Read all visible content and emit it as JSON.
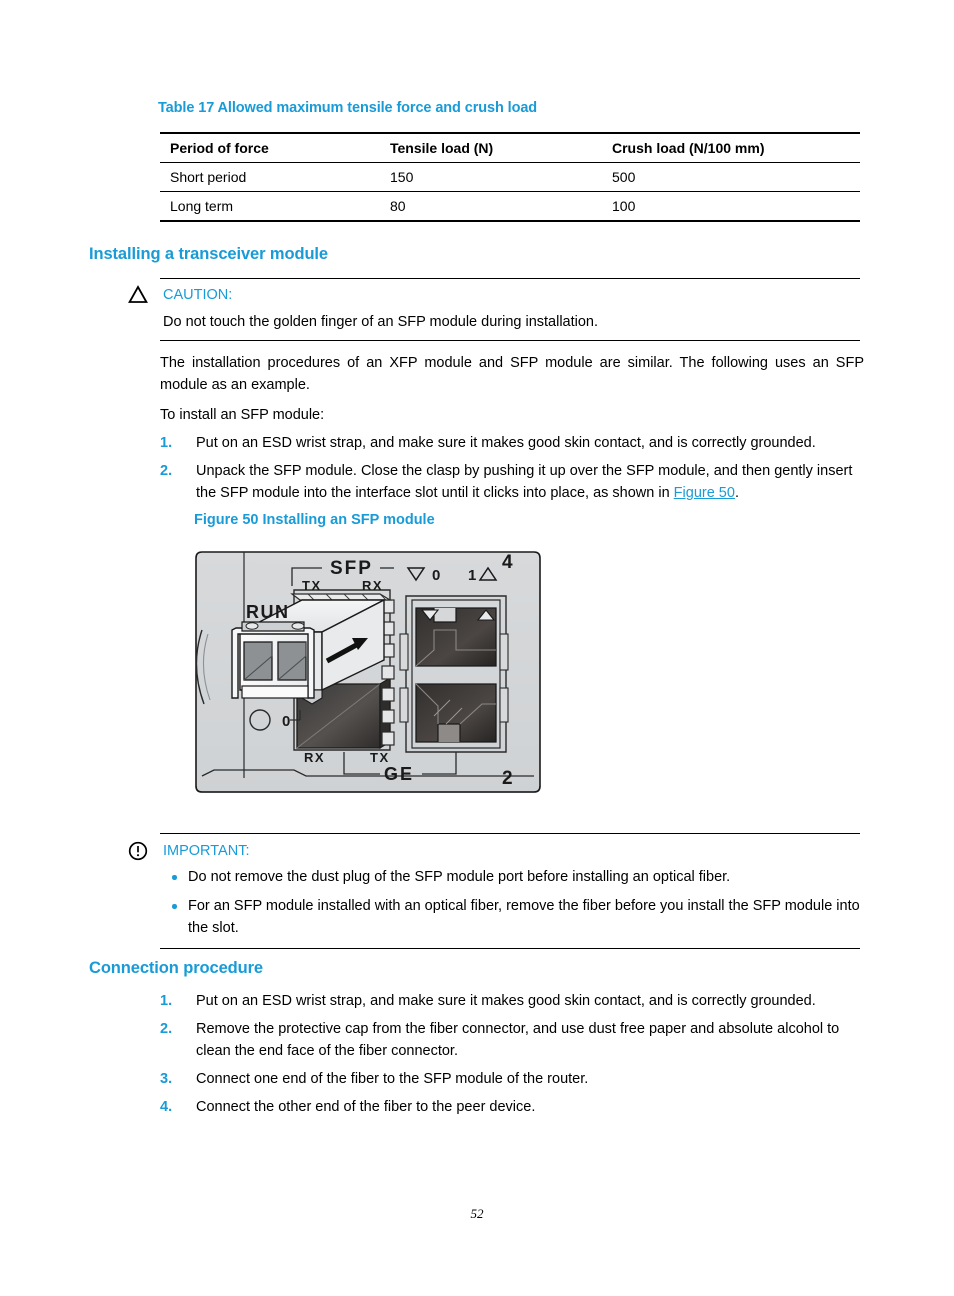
{
  "table": {
    "title": "Table 17 Allowed maximum tensile force and crush load",
    "headers": [
      "Period of force",
      "Tensile load (N)",
      "Crush load (N/100 mm)"
    ],
    "rows": [
      [
        "Short period",
        "150",
        "500"
      ],
      [
        "Long term",
        "80",
        "100"
      ]
    ]
  },
  "sections": {
    "installing_heading": "Installing a transceiver module",
    "connection_heading": "Connection procedure"
  },
  "caution": {
    "icon": "warning-triangle-icon",
    "label": "CAUTION:",
    "text": "Do not touch the golden finger of an SFP module during installation."
  },
  "important": {
    "icon": "exclamation-circle-icon",
    "label": "IMPORTANT:",
    "bullets": [
      "Do not remove the dust plug of the SFP module port before installing an optical fiber.",
      "For an SFP module installed with an optical fiber, remove the fiber before you install the SFP module into the slot."
    ]
  },
  "paragraphs": {
    "intro": "The installation procedures of an XFP module and SFP module are similar. The following uses an SFP module as an example.",
    "to_install": "To install an SFP module:"
  },
  "install_steps": [
    {
      "num": "1.",
      "text": "Put on an ESD wrist strap, and make sure it makes good skin contact, and is correctly grounded.",
      "text_before_link": "",
      "link": "",
      "text_after_link": ""
    },
    {
      "num": "2.",
      "text": "Unpack the SFP module. Close the clasp by pushing it up over the SFP module, and then gently insert the SFP module into the interface slot until it clicks into place, as shown in Figure 50.",
      "text_before_link": "Unpack the SFP module. Close the clasp by pushing it up over the SFP module, and then gently insert the SFP module into the interface slot until it clicks into place, as shown in ",
      "link": "Figure 50",
      "text_after_link": "."
    }
  ],
  "figure": {
    "caption": "Figure 50 Installing an SFP module",
    "labels": {
      "sfp": "SFP",
      "tx_top": "TX",
      "rx_top": "RX",
      "run": "RUN",
      "rx_bottom": "RX",
      "tx_bottom": "TX",
      "ge": "GE",
      "port_1": "1",
      "port_2": "2",
      "port_4": "4",
      "zero_top": "0",
      "zero_left": "0"
    }
  },
  "connection_steps": [
    {
      "num": "1.",
      "text": "Put on an ESD wrist strap, and make sure it makes good skin contact, and is correctly grounded."
    },
    {
      "num": "2.",
      "text": "Remove the protective cap from the fiber connector, and use dust free paper and absolute alcohol to clean the end face of the fiber connector."
    },
    {
      "num": "3.",
      "text": "Connect one end of the fiber to the SFP module of the router."
    },
    {
      "num": "4.",
      "text": "Connect the other end of the fiber to the peer device."
    }
  ],
  "footer": {
    "page_number": "52"
  },
  "colors": {
    "accent_blue": "#189BD7",
    "text_black": "#000000"
  }
}
